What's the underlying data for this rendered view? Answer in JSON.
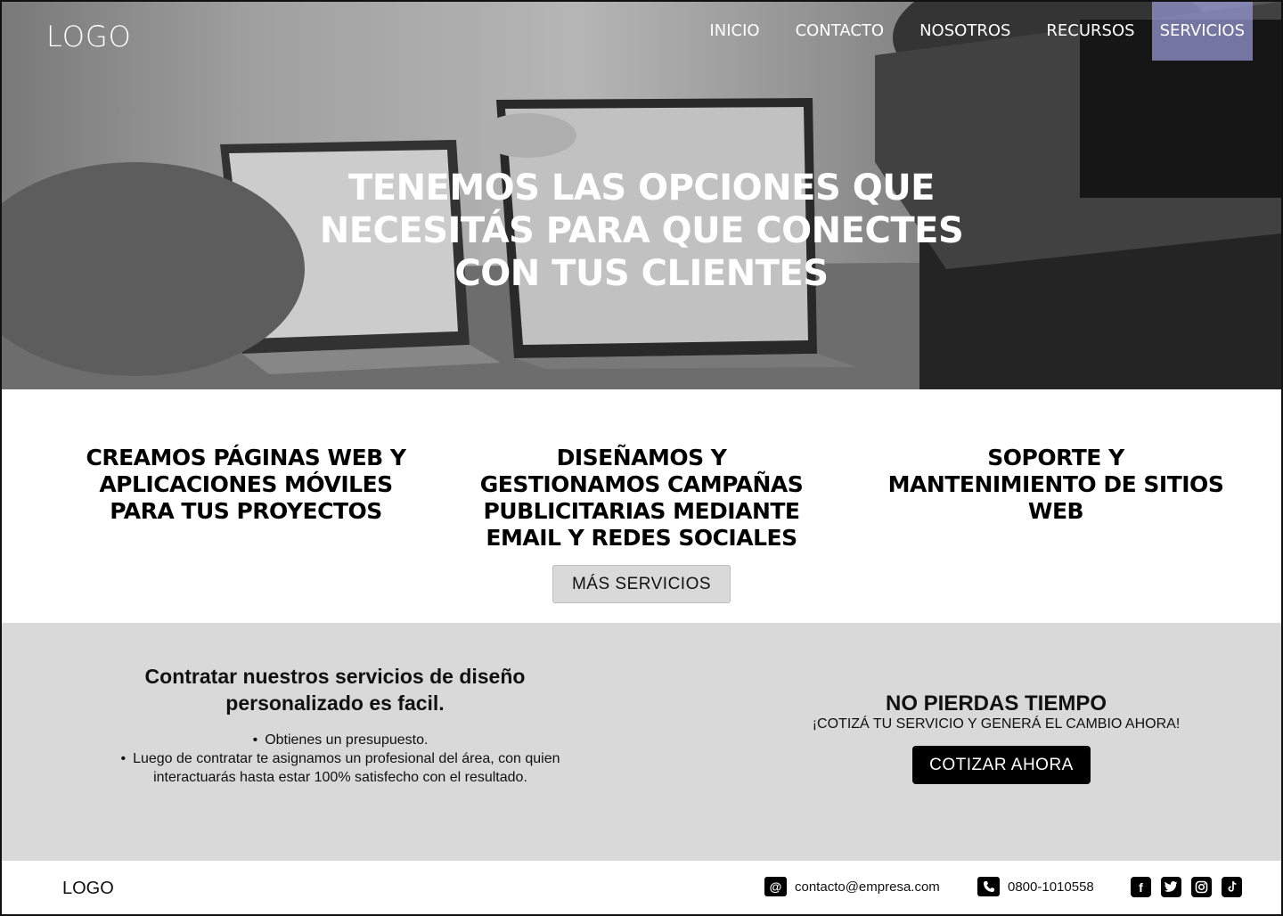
{
  "header": {
    "logo": "LOGO",
    "nav": [
      {
        "label": "INICIO"
      },
      {
        "label": "CONTACTO"
      },
      {
        "label": "NOSOTROS"
      },
      {
        "label": "RECURSOS"
      },
      {
        "label": "SERVICIOS",
        "active": true
      }
    ]
  },
  "hero": {
    "title": "TENEMOS LAS OPCIONES QUE NECESITÁS PARA QUE CONECTES CON TUS CLIENTES"
  },
  "services": {
    "items": [
      {
        "title": "CREAMOS PÁGINAS WEB Y APLICACIONES MÓVILES PARA TUS PROYECTOS"
      },
      {
        "title": "DISEÑAMOS Y GESTIONAMOS CAMPAÑAS PUBLICITARIAS MEDIANTE EMAIL Y REDES SOCIALES"
      },
      {
        "title": "SOPORTE Y MANTENIMIENTO DE SITIOS WEB"
      }
    ],
    "more_button": "MÁS SERVICIOS"
  },
  "info": {
    "title": "Contratar nuestros servicios de diseño personalizado es facil.",
    "steps": [
      "Obtienes un presupuesto.",
      "Luego de contratar te asignamos un profesional del área, con quien interactuarás hasta estar 100% satisfecho con el resultado."
    ]
  },
  "cta": {
    "title": "NO PIERDAS TIEMPO",
    "subtitle": "¡COTIZÁ TU SERVICIO Y GENERÁ EL CAMBIO AHORA!",
    "button": "COTIZAR AHORA"
  },
  "footer": {
    "logo": "LOGO",
    "email": "contacto@empresa.com",
    "phone": "0800-1010558",
    "socials": [
      "facebook-icon",
      "twitter-icon",
      "instagram-icon",
      "tiktok-icon"
    ]
  },
  "colors": {
    "nav_active_bg": "#9696d2",
    "services_bg": "#ffffff",
    "info_bg": "#d9d9d9",
    "cta_button_bg": "#000000",
    "secondary_button_bg": "#d9d9d9"
  }
}
